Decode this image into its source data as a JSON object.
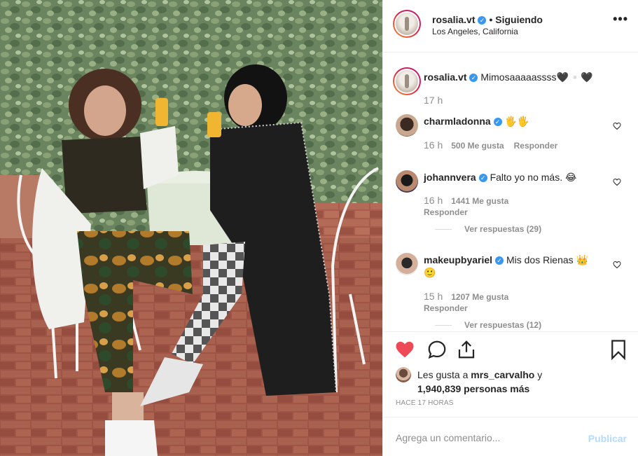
{
  "post": {
    "header": {
      "username": "rosalia.vt",
      "follow_status": "• Siguiendo",
      "location": "Los Angeles, California",
      "more_icon": "more-dots-icon"
    },
    "caption": {
      "username": "rosalia.vt",
      "text": "Mimosaaaaassss🖤▫️🖤",
      "time": "17 h"
    },
    "comments": [
      {
        "username": "charmladonna",
        "verified": true,
        "text": "🖐🖐",
        "time": "16 h",
        "likes": "500 Me gusta",
        "reply": "Responder"
      },
      {
        "username": "johannvera",
        "verified": true,
        "text": "Falto yo no más. 😂",
        "time": "16 h",
        "likes": "1441 Me gusta",
        "reply": "Responder",
        "view_replies": "Ver respuestas (29)"
      },
      {
        "username": "makeupbyariel",
        "verified": true,
        "text": "Mis dos Rienas 👑🙂",
        "time": "15 h",
        "likes": "1207 Me gusta",
        "reply": "Responder",
        "view_replies": "Ver respuestas (12)"
      }
    ],
    "likes_line": {
      "prefix": "Les gusta a ",
      "user": "mrs_carvalho",
      "suffix": " y",
      "count": "1,940,839 personas más"
    },
    "timestamp": "HACE 17 HORAS",
    "comment_input": {
      "placeholder": "Agrega un comentario...",
      "post_label": "Publicar"
    },
    "colors": {
      "heart": "#ed4956",
      "verified": "#3897f0",
      "publish": "#b3dbff"
    }
  }
}
